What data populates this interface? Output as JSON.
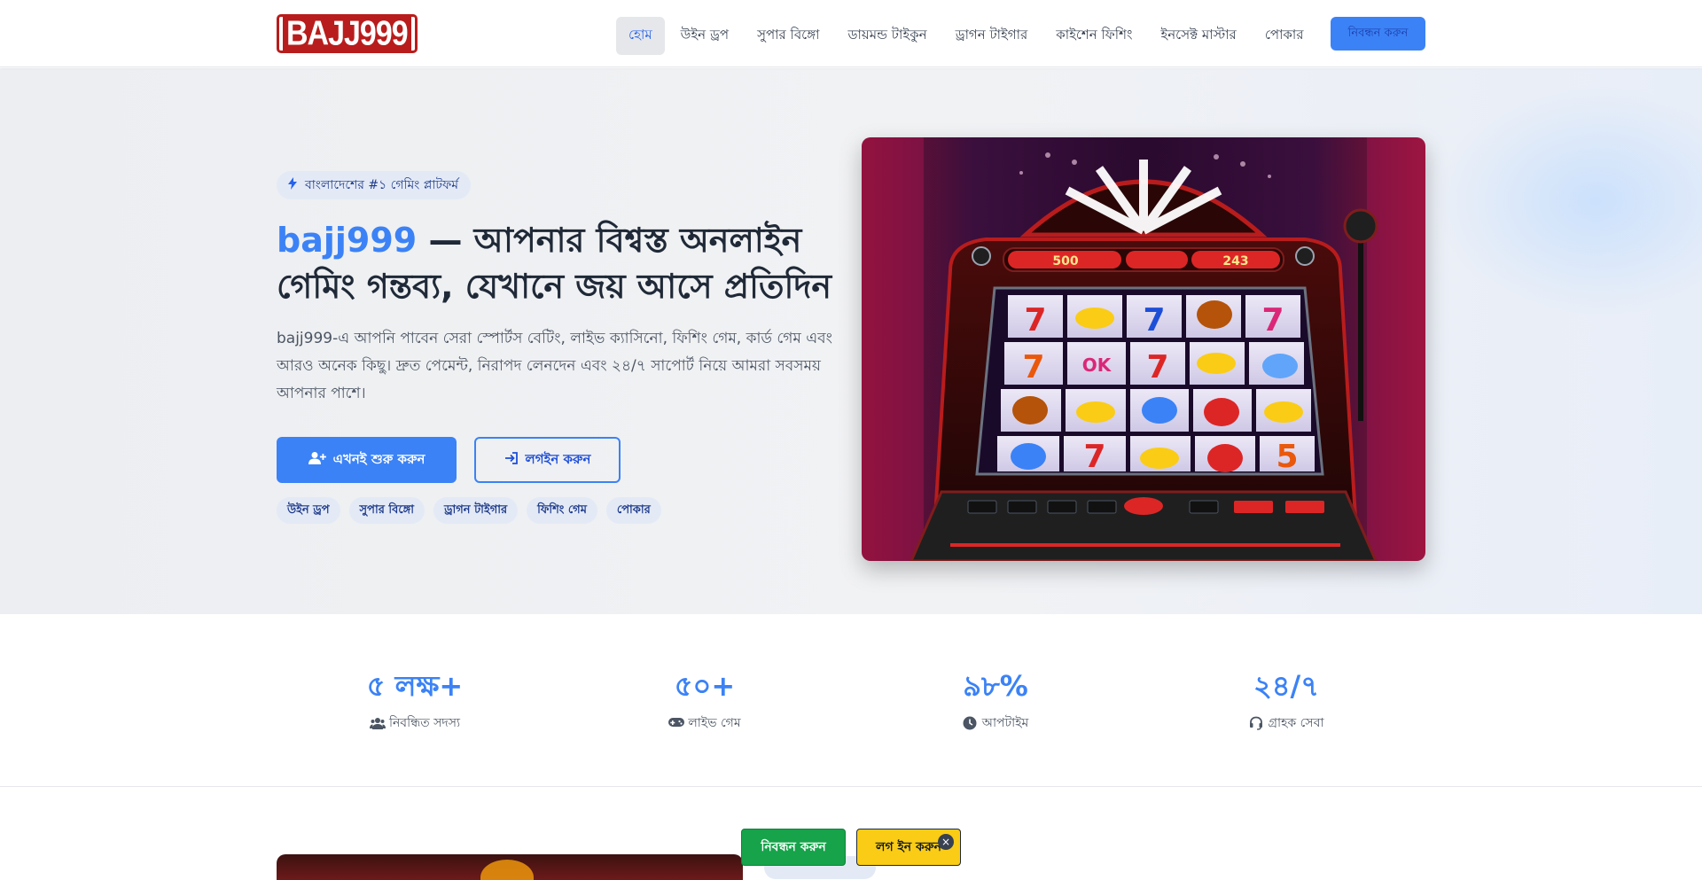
{
  "header": {
    "logo_text": "BAJJ999",
    "nav": [
      {
        "label": "হোম",
        "active": true
      },
      {
        "label": "উইন ড্রপ"
      },
      {
        "label": "সুপার বিঙ্গো"
      },
      {
        "label": "ডায়মন্ড টাইকুন"
      },
      {
        "label": "ড্রাগন টাইগার"
      },
      {
        "label": "কাইশেন ফিশিং"
      },
      {
        "label": "ইনসেক্ট মাস্টার"
      },
      {
        "label": "পোকার"
      }
    ],
    "cta_label": "নিবন্ধন করুন"
  },
  "hero": {
    "badge": "বাংলাদেশের #১ গেমিং প্লাটফর্ম",
    "title_brand": "bajj999",
    "title_rest": " — আপনার বিশ্বস্ত অনলাইন গেমিং গন্তব্য, যেখানে জয় আসে প্রতিদিন",
    "description": "bajj999-এ আপনি পাবেন সেরা স্পোর্টস বেটিং, লাইভ ক্যাসিনো, ফিশিং গেম, কার্ড গেম এবং আরও অনেক কিছু। দ্রুত পেমেন্ট, নিরাপদ লেনদেন এবং ২৪/৭ সাপোর্ট নিয়ে আমরা সবসময় আপনার পাশে।",
    "primary_button": "এখনই শুরু করুন",
    "secondary_button": "লগইন করুন",
    "chips": [
      "উইন ড্রপ",
      "সুপার বিঙ্গো",
      "ড্রাগন টাইগার",
      "ফিশিং গেম",
      "পোকার"
    ],
    "slot_display": {
      "left": "500",
      "right": "243"
    }
  },
  "stats": [
    {
      "value": "৫ লক্ষ+",
      "label": "নিবন্ধিত সদস্য",
      "icon": "users-icon"
    },
    {
      "value": "৫০+",
      "label": "লাইভ গেম",
      "icon": "gamepad-icon"
    },
    {
      "value": "৯৮%",
      "label": "আপটাইম",
      "icon": "clock-icon"
    },
    {
      "value": "২৪/৭",
      "label": "গ্রাহক সেবা",
      "icon": "headset-icon"
    }
  ],
  "floating": {
    "register": "নিবন্ধন করুন",
    "login": "লগ ইন করুন",
    "close": "×"
  },
  "colors": {
    "accent": "#3b82f6",
    "brand_red": "#b91c1c",
    "register_green": "#16a34a",
    "login_yellow": "#facc15"
  }
}
